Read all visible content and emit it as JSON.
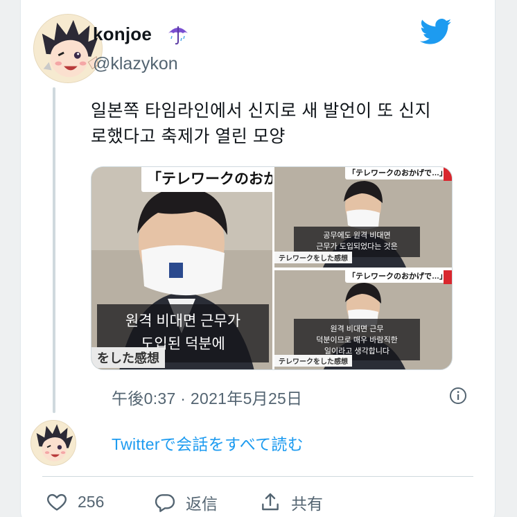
{
  "user": {
    "name": "konjoe",
    "handle": "@klazykon"
  },
  "tweet": {
    "text_line1": "일본쪽 타임라인에서 신지로 새 발언이 또 신지",
    "text_line2": "로했다고 축제가 열린 모양",
    "timestamp": "午後0:37 · 2021年5月25日"
  },
  "media": {
    "left": {
      "banner": "「テレワークのおか",
      "subtitle_line1": "원격 비대면 근무가",
      "subtitle_line2": "도입된 덕분에",
      "caption": "をした感想"
    },
    "right_top": {
      "banner": "「テレワークのおかげで…」",
      "subtitle_line1": "공무에도 원격 비대면",
      "subtitle_line2": "근무가 도입되었다는 것은",
      "caption": "テレワークをした感想"
    },
    "right_bottom": {
      "banner": "「テレワークのおかげで…」",
      "subtitle_line1": "원격 비대면 근무",
      "subtitle_line2": "덕분이므로 매우 바람직한",
      "subtitle_line3": "일이라고 생각합니다",
      "caption": "テレワークをした感想"
    }
  },
  "thread": {
    "read_all": "Twitterで会話をすべて読む"
  },
  "actions": {
    "like_count": "256",
    "reply_label": "返信",
    "share_label": "共有"
  },
  "colors": {
    "twitter_blue": "#1d9bf0",
    "secondary_text": "#536471",
    "divider": "#cfd9de"
  },
  "icons": [
    "avatar-icon",
    "umbrella-emoji-icon",
    "twitter-bird-icon",
    "info-icon",
    "heart-icon",
    "reply-icon",
    "share-icon"
  ]
}
